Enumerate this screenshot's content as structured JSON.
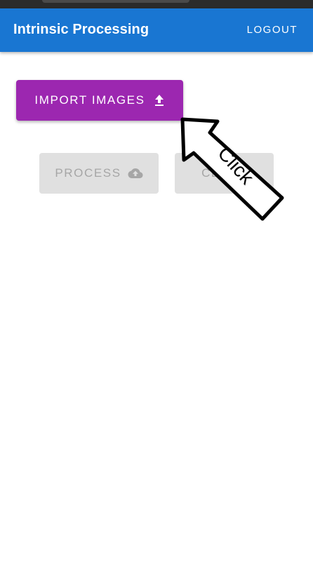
{
  "app_bar": {
    "title": "Intrinsic Processing",
    "logout_label": "LOGOUT",
    "color": "#1976d2"
  },
  "actions": {
    "import_label": "IMPORT IMAGES",
    "import_icon": "upload-icon",
    "import_color": "#9c27b0",
    "process_label": "PROCESS",
    "process_icon": "cloud-upload-icon",
    "process_enabled": false,
    "clear_label": "CLEAR",
    "clear_enabled": false
  },
  "annotation": {
    "label": "Click",
    "icon": "pointer-arrow-icon"
  }
}
